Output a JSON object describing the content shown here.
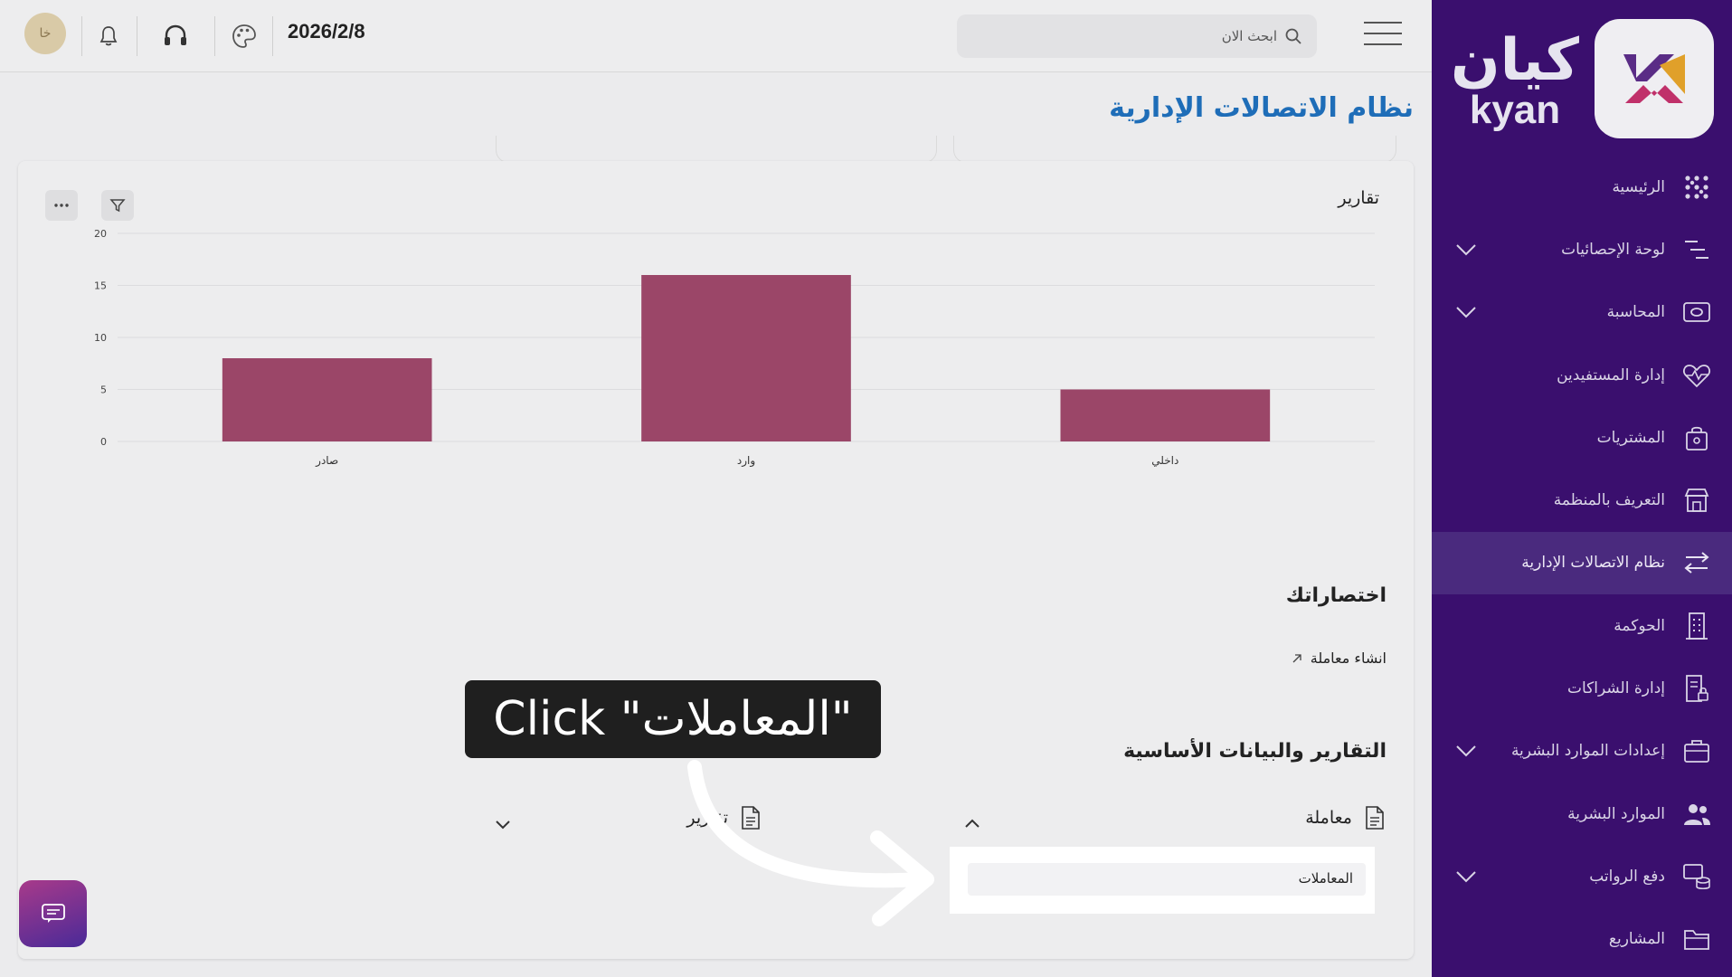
{
  "sidebar": {
    "logo_ar": "كيان",
    "logo_en": "kyan",
    "items": [
      {
        "label": "الرئيسية",
        "icon": "grid-dots-icon",
        "chevron": false,
        "active": false
      },
      {
        "label": "لوحة الإحصائيات",
        "icon": "chart-lines-icon",
        "chevron": true,
        "active": false
      },
      {
        "label": "المحاسبة",
        "icon": "money-icon",
        "chevron": true,
        "active": false
      },
      {
        "label": "إدارة المستفيدين",
        "icon": "heart-pulse-icon",
        "chevron": false,
        "active": false
      },
      {
        "label": "المشتريات",
        "icon": "bag-icon",
        "chevron": false,
        "active": false
      },
      {
        "label": "التعريف بالمنظمة",
        "icon": "store-icon",
        "chevron": false,
        "active": false
      },
      {
        "label": "نظام الاتصالات الإدارية",
        "icon": "arrows-exchange-icon",
        "chevron": false,
        "active": true
      },
      {
        "label": "الحوكمة",
        "icon": "building-icon",
        "chevron": false,
        "active": false
      },
      {
        "label": "إدارة الشراكات",
        "icon": "document-lock-icon",
        "chevron": false,
        "active": false
      },
      {
        "label": "إعدادات الموارد البشرية",
        "icon": "briefcase-icon",
        "chevron": true,
        "active": false
      },
      {
        "label": "الموارد البشرية",
        "icon": "users-icon",
        "chevron": false,
        "active": false
      },
      {
        "label": "دفع الرواتب",
        "icon": "coins-icon",
        "chevron": true,
        "active": false
      },
      {
        "label": "المشاريع",
        "icon": "folder-icon",
        "chevron": false,
        "active": false
      }
    ]
  },
  "header": {
    "search_placeholder": "ابحث الان",
    "date": "2026/2/8",
    "avatar_initials": "خا"
  },
  "page": {
    "title": "نظام الاتصالات الإدارية",
    "reports_title": "تقارير",
    "shortcuts_title": "اختصاراتك",
    "shortcut_link": "انشاء معاملة",
    "reports_section_title": "التقارير والبيانات الأساسية",
    "accordion_transaction": "معاملة",
    "accordion_reports": "تقارير",
    "dropdown_item": "المعاملات"
  },
  "chart_data": {
    "type": "bar",
    "categories": [
      "صادر",
      "وارد",
      "داخلي"
    ],
    "values": [
      8,
      16,
      5
    ],
    "ylim": [
      0,
      20
    ],
    "yticks": [
      0,
      5,
      10,
      15,
      20
    ],
    "grid": true,
    "bar_color": "#9b4668",
    "title": "",
    "xlabel": "",
    "ylabel": ""
  },
  "overlay": {
    "hint_text": "Click \"المعاملات\""
  },
  "colors": {
    "sidebar_bg": "#3a0f6e",
    "accent_blue": "#1e6db8",
    "bar": "#9b4668"
  }
}
